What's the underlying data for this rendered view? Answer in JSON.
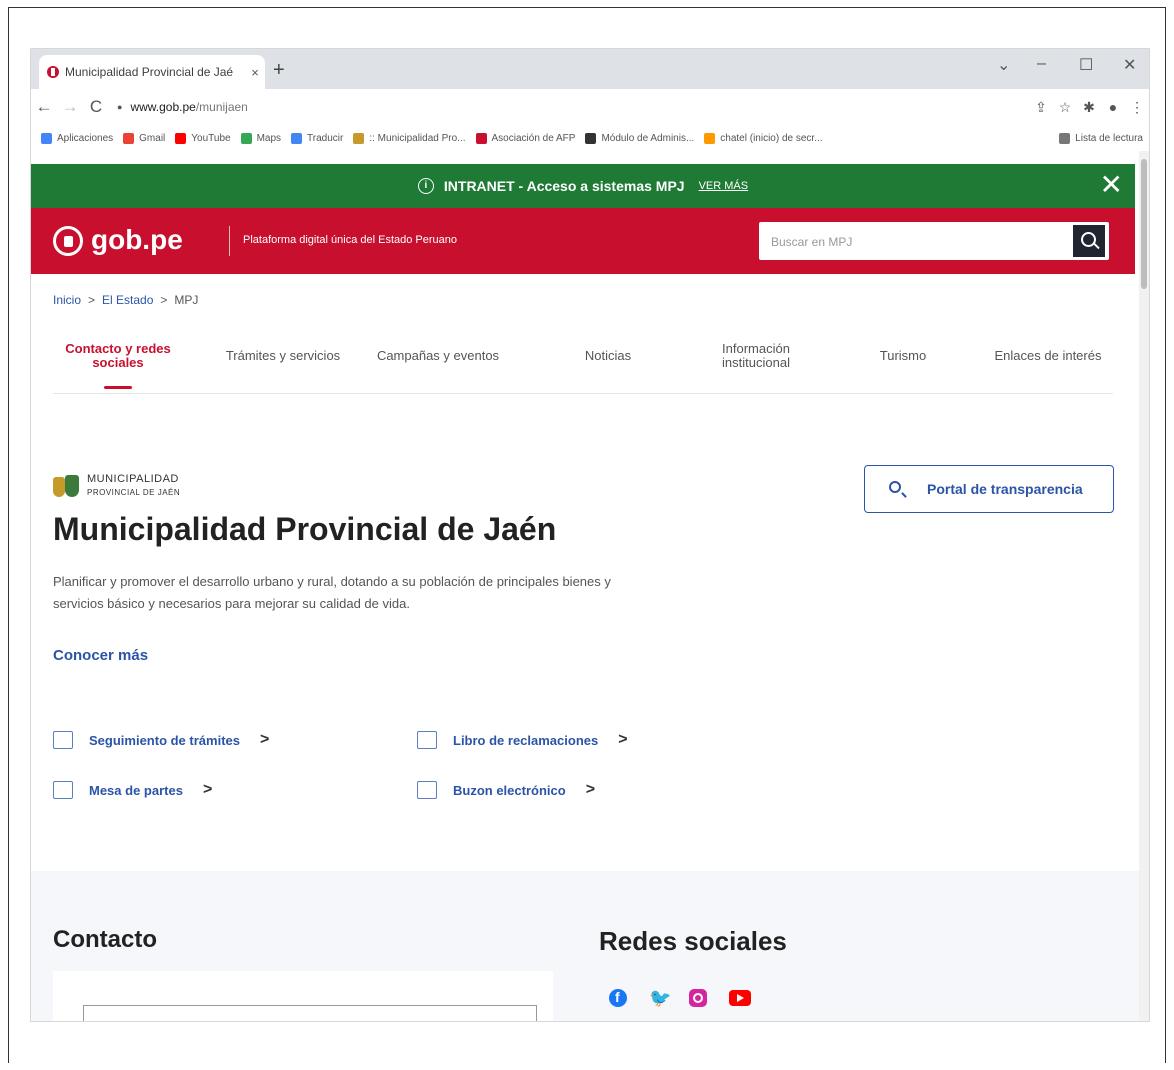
{
  "browser": {
    "tab_title": "Municipalidad Provincial de Jaé",
    "tab_close": "×",
    "new_tab": "+",
    "window_controls": [
      "⌄",
      "–",
      "☐",
      "✕"
    ],
    "nav": [
      "←",
      "→",
      "C"
    ],
    "url_host": "www.gob.pe",
    "url_path": "/munijaen",
    "bookmarks": [
      {
        "label": "Aplicaciones",
        "color": "#4285f4"
      },
      {
        "label": "Gmail",
        "color": "#ea4335"
      },
      {
        "label": "YouTube",
        "color": "#ff0000"
      },
      {
        "label": "Maps",
        "color": "#34a853"
      },
      {
        "label": "Traducir",
        "color": "#4285f4"
      },
      {
        "label": ":: Municipalidad Pro...",
        "color": "#c59a28"
      },
      {
        "label": "Asociación de AFP",
        "color": "#c8102e"
      },
      {
        "label": "Módulo de Adminis...",
        "color": "#333333"
      },
      {
        "label": "chatel (inicio) de secr...",
        "color": "#ff9900"
      }
    ],
    "reading_list": "Lista de lectura"
  },
  "intranet": {
    "text": "INTRANET - Acceso a sistemas MPJ",
    "link": "VER MÁS",
    "close": "✕",
    "bg_color": "#1f7a36"
  },
  "header": {
    "brand": "gob.pe",
    "tagline": "Plataforma digital única del Estado Peruano",
    "search_placeholder": "Buscar en MPJ",
    "bg_color": "#c8102e"
  },
  "breadcrumb": {
    "items": [
      "Inicio",
      "El Estado",
      "MPJ"
    ],
    "separator": ">"
  },
  "navtabs": [
    "Contacto y redes sociales",
    "Trámites y servicios",
    "Campañas y eventos",
    "Noticias",
    "Información institucional",
    "Turismo",
    "Enlaces de interés"
  ],
  "logo": {
    "line1": "MUNICIPALIDAD",
    "line2": "PROVINCIAL DE JAÉN"
  },
  "main": {
    "title": "Municipalidad Provincial de Jaén",
    "description": "Planificar y promover el desarrollo urbano y rural, dotando a su población de principales bienes y servicios básico y necesarios para mejorar su calidad de vida.",
    "conocer_mas": "Conocer más",
    "portal_button": "Portal de transparencia",
    "quick_links": [
      "Seguimiento de trámites",
      "Libro de reclamaciones",
      "Mesa de partes",
      "Buzon electrónico"
    ],
    "chevron": ">"
  },
  "footer": {
    "contacto": "Contacto",
    "redes": "Redes sociales"
  }
}
